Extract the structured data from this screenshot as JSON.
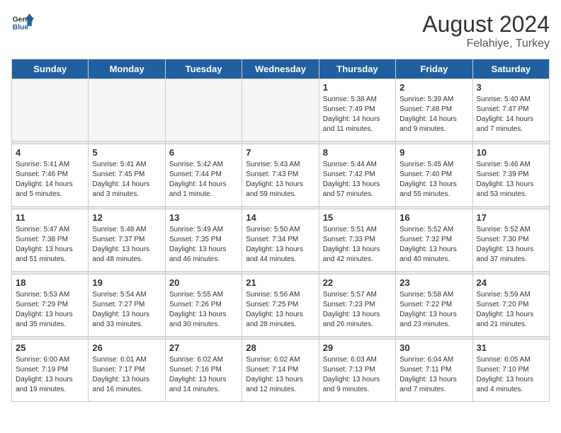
{
  "header": {
    "logo_line1": "General",
    "logo_line2": "Blue",
    "month_year": "August 2024",
    "location": "Felahiye, Turkey"
  },
  "weekdays": [
    "Sunday",
    "Monday",
    "Tuesday",
    "Wednesday",
    "Thursday",
    "Friday",
    "Saturday"
  ],
  "weeks": [
    [
      {
        "day": "",
        "info": ""
      },
      {
        "day": "",
        "info": ""
      },
      {
        "day": "",
        "info": ""
      },
      {
        "day": "",
        "info": ""
      },
      {
        "day": "1",
        "info": "Sunrise: 5:38 AM\nSunset: 7:49 PM\nDaylight: 14 hours\nand 11 minutes."
      },
      {
        "day": "2",
        "info": "Sunrise: 5:39 AM\nSunset: 7:48 PM\nDaylight: 14 hours\nand 9 minutes."
      },
      {
        "day": "3",
        "info": "Sunrise: 5:40 AM\nSunset: 7:47 PM\nDaylight: 14 hours\nand 7 minutes."
      }
    ],
    [
      {
        "day": "4",
        "info": "Sunrise: 5:41 AM\nSunset: 7:46 PM\nDaylight: 14 hours\nand 5 minutes."
      },
      {
        "day": "5",
        "info": "Sunrise: 5:41 AM\nSunset: 7:45 PM\nDaylight: 14 hours\nand 3 minutes."
      },
      {
        "day": "6",
        "info": "Sunrise: 5:42 AM\nSunset: 7:44 PM\nDaylight: 14 hours\nand 1 minute."
      },
      {
        "day": "7",
        "info": "Sunrise: 5:43 AM\nSunset: 7:43 PM\nDaylight: 13 hours\nand 59 minutes."
      },
      {
        "day": "8",
        "info": "Sunrise: 5:44 AM\nSunset: 7:42 PM\nDaylight: 13 hours\nand 57 minutes."
      },
      {
        "day": "9",
        "info": "Sunrise: 5:45 AM\nSunset: 7:40 PM\nDaylight: 13 hours\nand 55 minutes."
      },
      {
        "day": "10",
        "info": "Sunrise: 5:46 AM\nSunset: 7:39 PM\nDaylight: 13 hours\nand 53 minutes."
      }
    ],
    [
      {
        "day": "11",
        "info": "Sunrise: 5:47 AM\nSunset: 7:38 PM\nDaylight: 13 hours\nand 51 minutes."
      },
      {
        "day": "12",
        "info": "Sunrise: 5:48 AM\nSunset: 7:37 PM\nDaylight: 13 hours\nand 48 minutes."
      },
      {
        "day": "13",
        "info": "Sunrise: 5:49 AM\nSunset: 7:35 PM\nDaylight: 13 hours\nand 46 minutes."
      },
      {
        "day": "14",
        "info": "Sunrise: 5:50 AM\nSunset: 7:34 PM\nDaylight: 13 hours\nand 44 minutes."
      },
      {
        "day": "15",
        "info": "Sunrise: 5:51 AM\nSunset: 7:33 PM\nDaylight: 13 hours\nand 42 minutes."
      },
      {
        "day": "16",
        "info": "Sunrise: 5:52 AM\nSunset: 7:32 PM\nDaylight: 13 hours\nand 40 minutes."
      },
      {
        "day": "17",
        "info": "Sunrise: 5:52 AM\nSunset: 7:30 PM\nDaylight: 13 hours\nand 37 minutes."
      }
    ],
    [
      {
        "day": "18",
        "info": "Sunrise: 5:53 AM\nSunset: 7:29 PM\nDaylight: 13 hours\nand 35 minutes."
      },
      {
        "day": "19",
        "info": "Sunrise: 5:54 AM\nSunset: 7:27 PM\nDaylight: 13 hours\nand 33 minutes."
      },
      {
        "day": "20",
        "info": "Sunrise: 5:55 AM\nSunset: 7:26 PM\nDaylight: 13 hours\nand 30 minutes."
      },
      {
        "day": "21",
        "info": "Sunrise: 5:56 AM\nSunset: 7:25 PM\nDaylight: 13 hours\nand 28 minutes."
      },
      {
        "day": "22",
        "info": "Sunrise: 5:57 AM\nSunset: 7:23 PM\nDaylight: 13 hours\nand 26 minutes."
      },
      {
        "day": "23",
        "info": "Sunrise: 5:58 AM\nSunset: 7:22 PM\nDaylight: 13 hours\nand 23 minutes."
      },
      {
        "day": "24",
        "info": "Sunrise: 5:59 AM\nSunset: 7:20 PM\nDaylight: 13 hours\nand 21 minutes."
      }
    ],
    [
      {
        "day": "25",
        "info": "Sunrise: 6:00 AM\nSunset: 7:19 PM\nDaylight: 13 hours\nand 19 minutes."
      },
      {
        "day": "26",
        "info": "Sunrise: 6:01 AM\nSunset: 7:17 PM\nDaylight: 13 hours\nand 16 minutes."
      },
      {
        "day": "27",
        "info": "Sunrise: 6:02 AM\nSunset: 7:16 PM\nDaylight: 13 hours\nand 14 minutes."
      },
      {
        "day": "28",
        "info": "Sunrise: 6:02 AM\nSunset: 7:14 PM\nDaylight: 13 hours\nand 12 minutes."
      },
      {
        "day": "29",
        "info": "Sunrise: 6:03 AM\nSunset: 7:13 PM\nDaylight: 13 hours\nand 9 minutes."
      },
      {
        "day": "30",
        "info": "Sunrise: 6:04 AM\nSunset: 7:11 PM\nDaylight: 13 hours\nand 7 minutes."
      },
      {
        "day": "31",
        "info": "Sunrise: 6:05 AM\nSunset: 7:10 PM\nDaylight: 13 hours\nand 4 minutes."
      }
    ]
  ]
}
